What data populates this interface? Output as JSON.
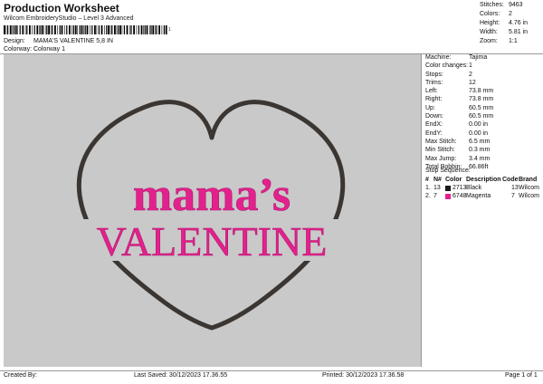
{
  "header": {
    "title": "Production Worksheet",
    "subtitle": "Wilcom EmbroideryStudio – Level 3 Advanced",
    "barcode_text": "1",
    "design_label": "Design:",
    "design_value": "MAMA'S VALENTINE 5,8 IN",
    "colorway_label": "Colorway:",
    "colorway_value": "Colorway 1"
  },
  "stats": [
    {
      "k": "Stitches:",
      "v": "9463"
    },
    {
      "k": "Colors:",
      "v": "2"
    },
    {
      "k": "Height:",
      "v": "4.76 in"
    },
    {
      "k": "Width:",
      "v": "5.81 in"
    },
    {
      "k": "Zoom:",
      "v": "1:1"
    }
  ],
  "design_preview": {
    "line1": "mama’s",
    "line2": "VALENTINE",
    "heart_color": "#3b3632",
    "text_color": "#e3218d",
    "background": "#c9c9c9"
  },
  "info": [
    {
      "k": "Machine:",
      "v": "Tajima"
    },
    {
      "k": "Color changes:",
      "v": "1"
    },
    {
      "k": "Stops:",
      "v": "2"
    },
    {
      "k": "Trims:",
      "v": "12"
    },
    {
      "k": "Left:",
      "v": "73.8 mm"
    },
    {
      "k": "Right:",
      "v": "73.8 mm"
    },
    {
      "k": "Up:",
      "v": "60.5 mm"
    },
    {
      "k": "Down:",
      "v": "60.5 mm"
    },
    {
      "k": "EndX:",
      "v": "0.00 in"
    },
    {
      "k": "EndY:",
      "v": "0.00 in"
    },
    {
      "k": "Max Stitch:",
      "v": "6.5 mm"
    },
    {
      "k": "Min Stitch:",
      "v": "0.3 mm"
    },
    {
      "k": "Max Jump:",
      "v": "3.4 mm"
    },
    {
      "k": "Total Bobbin:",
      "v": "66.86ft"
    }
  ],
  "sequence": {
    "title": "Stop Sequence:",
    "headers": [
      "#",
      "N#",
      "Color",
      "Description",
      "Code",
      "Brand"
    ],
    "rows": [
      {
        "idx": "1.",
        "n": "13",
        "code_num": "2713",
        "color": "#1a1a1a",
        "description": "Black",
        "code": "13",
        "brand": "Wilcom"
      },
      {
        "idx": "2.",
        "n": "7",
        "code_num": "6748",
        "color": "#e3218d",
        "description": "Magenta",
        "code": "7",
        "brand": "Wilcom"
      }
    ]
  },
  "footer": {
    "created_by": "Created By:",
    "last_saved": "Last Saved: 30/12/2023 17.36.55",
    "printed": "Printed: 30/12/2023 17.36.58",
    "page": "Page 1 of 1"
  }
}
